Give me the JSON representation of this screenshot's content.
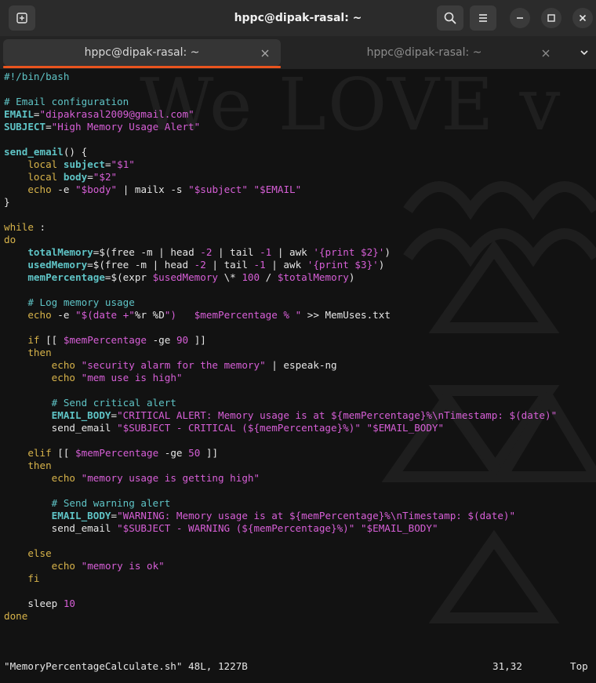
{
  "window": {
    "title": "hppc@dipak-rasal: ~"
  },
  "header_buttons": {
    "new_tab_icon": "new-tab-icon",
    "search_icon": "search-icon",
    "menu_icon": "hamburger-menu-icon",
    "minimize_icon": "minimize-icon",
    "maximize_icon": "maximize-icon",
    "close_icon": "close-icon"
  },
  "tabs": [
    {
      "label": "hppc@dipak-rasal: ~",
      "active": true
    },
    {
      "label": "hppc@dipak-rasal: ~",
      "active": false
    }
  ],
  "watermark": {
    "text": "We LOVE v"
  },
  "code_lines": [
    "#!/bin/bash",
    "",
    "# Email configuration",
    "EMAIL=\"dipakrasal2009@gmail.com\"",
    "SUBJECT=\"High Memory Usage Alert\"",
    "",
    "send_email() {",
    "    local subject=\"$1\"",
    "    local body=\"$2\"",
    "    echo -e \"$body\" | mailx -s \"$subject\" \"$EMAIL\"",
    "}",
    "",
    "while :",
    "do",
    "    totalMemory=$(free -m | head -2 | tail -1 | awk '{print $2}')",
    "    usedMemory=$(free -m | head -2 | tail -1 | awk '{print $3}')",
    "    memPercentage=$(expr $usedMemory \\* 100 / $totalMemory)",
    "",
    "    # Log memory usage",
    "    echo -e \"$(date +\"%r %D\")   $memPercentage % \" >> MemUses.txt",
    "",
    "    if [[ $memPercentage -ge 90 ]]",
    "    then",
    "        echo \"security alarm for the memory\" | espeak-ng",
    "        echo \"mem use is high\"",
    "",
    "        # Send critical alert",
    "        EMAIL_BODY=\"CRITICAL ALERT: Memory usage is at ${memPercentage}%\\nTimestamp: $(date)\"",
    "        send_email \"$SUBJECT - CRITICAL (${memPercentage}%)\" \"$EMAIL_BODY\"",
    "",
    "    elif [[ $memPercentage -ge 50 ]]",
    "    then",
    "        echo \"memory usage is getting high\"",
    "",
    "        # Send warning alert",
    "        EMAIL_BODY=\"WARNING: Memory usage is at ${memPercentage}%\\nTimestamp: $(date)\"",
    "        send_email \"$SUBJECT - WARNING (${memPercentage}%)\" \"$EMAIL_BODY\"",
    "",
    "    else",
    "        echo \"memory is ok\"",
    "    fi",
    "",
    "    sleep 10",
    "done"
  ],
  "status": {
    "file": "\"MemoryPercentageCalculate.sh\" 48L, 1227B",
    "position": "31,32",
    "scroll": "Top"
  },
  "colors": {
    "accent": "#e9541e",
    "comment": "#5fc4c6",
    "string": "#d75fd7",
    "keyword": "#d7b34a",
    "background": "#121212"
  }
}
